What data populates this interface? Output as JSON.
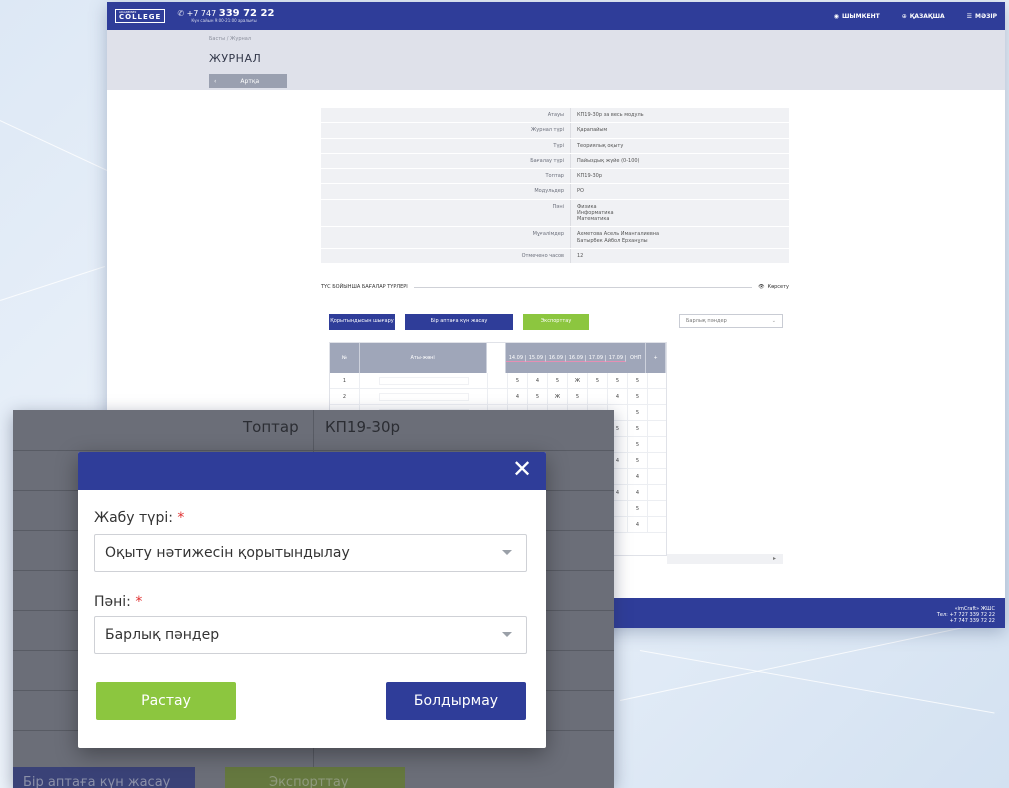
{
  "header": {
    "logo_top": "АКАДЕМИЯ",
    "logo_text": "COLLEGE",
    "phone_prefix": "+7 747",
    "phone_number": "339 72 22",
    "phone_hours": "Күн сайын 9:00-21:00 аралығы",
    "city": "ШЫМКЕНТ",
    "language": "ҚАЗАҚША",
    "menu": "МӘЗІР"
  },
  "breadcrumb": [
    "Басты",
    "Журнал"
  ],
  "page_title": "ЖУРНАЛ",
  "back_label": "Артқа",
  "info_rows": [
    {
      "k": "Атауы",
      "v": "КП19-30р за весь модуль"
    },
    {
      "k": "Журнал түрі",
      "v": "Қарапайым"
    },
    {
      "k": "Түрі",
      "v": "Теориялық оқыту"
    },
    {
      "k": "Бағалау түрі",
      "v": "Пайыздық жүйе (0-100)"
    },
    {
      "k": "Топтар",
      "v": "КП19-30р"
    },
    {
      "k": "Модульдер",
      "v": "РО"
    },
    {
      "k": "Пәні",
      "v": "Физика\nИнформатика\nМатематика"
    },
    {
      "k": "Мұғалімдер",
      "v": "Ахметова Асель Имангалиевна\nБатырбек Айбол Ерханұлы"
    },
    {
      "k": "Отмечено часов",
      "v": "12"
    }
  ],
  "section_title": "ТҮС БОЙЫНША БАҒАЛАР ТҮРЛЕРІ",
  "section_toggle": "Көрсету",
  "buttons": {
    "close_result": "Қорытындысын шығару",
    "weekly": "Бір аптаға күн жасау",
    "export": "Экспорттау"
  },
  "filter_dropdown": "Барлық пәндер",
  "grid": {
    "col_num": "№",
    "col_name": "Аты-жөні",
    "dates": [
      "14.09",
      "15.09",
      "16.09",
      "16.09",
      "17.09",
      "17.09"
    ],
    "col_avg": "ОНП",
    "add": "+",
    "rows": [
      {
        "n": "1",
        "cells": [
          "5",
          "4",
          "5",
          "Ж",
          "5",
          "5"
        ],
        "avg": "5"
      },
      {
        "n": "2",
        "cells": [
          "4",
          "5",
          "Ж",
          "5",
          "",
          "4"
        ],
        "avg": "5"
      },
      {
        "n": "",
        "cells": [
          "4",
          "4",
          "5",
          "5",
          "4",
          ""
        ],
        "avg": "5"
      },
      {
        "n": "",
        "cells": [
          "",
          "",
          "",
          "",
          "",
          "5"
        ],
        "avg": "5"
      },
      {
        "n": "",
        "cells": [
          "",
          "",
          "",
          "",
          "",
          ""
        ],
        "avg": "5"
      },
      {
        "n": "",
        "cells": [
          "",
          "",
          "",
          "",
          "",
          "4"
        ],
        "avg": "5"
      },
      {
        "n": "",
        "cells": [
          "",
          "",
          "",
          "",
          "",
          ""
        ],
        "avg": "4"
      },
      {
        "n": "",
        "cells": [
          "",
          "",
          "",
          "",
          "",
          "4"
        ],
        "avg": "4"
      },
      {
        "n": "",
        "cells": [
          "",
          "",
          "",
          "",
          "",
          ""
        ],
        "avg": "5"
      },
      {
        "n": "",
        "cells": [
          "",
          "",
          "",
          "",
          "",
          ""
        ],
        "avg": "4"
      }
    ]
  },
  "footer": {
    "company": "«imCraft» ЖШС",
    "tel1": "Тел: +7 727 339 72 22",
    "tel2": "+7 747 339 72 22"
  },
  "zoom": {
    "label": "Топтар",
    "value": "КП19-30р",
    "bg_btn1": "Бір аптаға күн жасау",
    "bg_btn2": "Экспорттау"
  },
  "modal": {
    "field1_label": "Жабу түрі:",
    "field1_value": "Оқыту нәтижесін қорытындылау",
    "field2_label": "Пәні:",
    "required_mark": "*",
    "field2_value": "Барлық пәндер",
    "confirm": "Растау",
    "cancel": "Болдырмау",
    "close_symbol": "✕"
  },
  "colors": {
    "brand_blue": "#2f3d99",
    "green": "#8cc63f",
    "overlay": "#6b6e78"
  }
}
